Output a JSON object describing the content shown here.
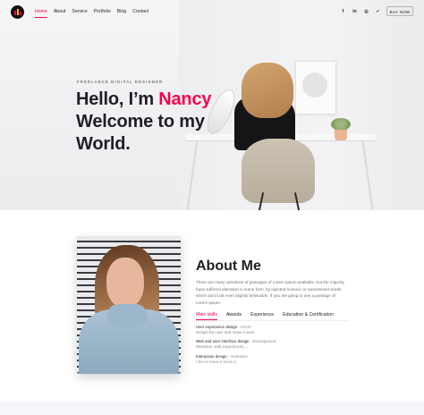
{
  "header": {
    "nav": [
      "Home",
      "About",
      "Service",
      "Portfolio",
      "Blog",
      "Contact"
    ],
    "socials": [
      {
        "icon": "facebook-icon",
        "glyph": "f"
      },
      {
        "icon": "linkedin-icon",
        "glyph": "in"
      },
      {
        "icon": "instagram-icon",
        "glyph": "◎"
      },
      {
        "icon": "twitter-icon",
        "glyph": "✓"
      }
    ],
    "buy_label": "BUY NOW"
  },
  "hero": {
    "subtitle": "FREELANCE DIGITAL DESIGNER",
    "line1_pre": "Hello, I’m ",
    "name": "Nancy",
    "line2": "Welcome to my",
    "line3": "World."
  },
  "about": {
    "title": "About Me",
    "description": "There are many variations of passages of Lorem Ipsum available, but the majority have suffered alteration in some form, by injected humour, or randomised words which dont look even slightly believable. If you are going to use a passage of Lorem Ipsum.",
    "tabs": [
      "Main skills",
      "Awards",
      "Experience",
      "Education & Certification"
    ],
    "skills": [
      {
        "title": "User experience design",
        "category": "UI/UX",
        "desc": "Delight the user and make it work."
      },
      {
        "title": "Web and user interface design",
        "category": "Development",
        "desc": "Websites, web experiences, ..."
      },
      {
        "title": "Interaction design",
        "category": "Animation",
        "desc": "I like to move it move it."
      }
    ]
  },
  "colors": {
    "accent": "#f9004d",
    "text": "#1f1f25"
  }
}
